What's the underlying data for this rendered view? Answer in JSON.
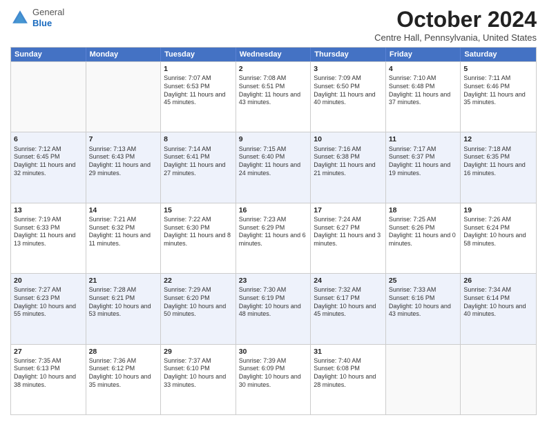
{
  "header": {
    "logo_line1": "General",
    "logo_line2": "Blue",
    "month": "October 2024",
    "location": "Centre Hall, Pennsylvania, United States"
  },
  "days": [
    "Sunday",
    "Monday",
    "Tuesday",
    "Wednesday",
    "Thursday",
    "Friday",
    "Saturday"
  ],
  "weeks": [
    [
      {
        "day": "",
        "sunrise": "",
        "sunset": "",
        "daylight": "",
        "empty": true
      },
      {
        "day": "",
        "sunrise": "",
        "sunset": "",
        "daylight": "",
        "empty": true
      },
      {
        "day": "1",
        "sunrise": "Sunrise: 7:07 AM",
        "sunset": "Sunset: 6:53 PM",
        "daylight": "Daylight: 11 hours and 45 minutes."
      },
      {
        "day": "2",
        "sunrise": "Sunrise: 7:08 AM",
        "sunset": "Sunset: 6:51 PM",
        "daylight": "Daylight: 11 hours and 43 minutes."
      },
      {
        "day": "3",
        "sunrise": "Sunrise: 7:09 AM",
        "sunset": "Sunset: 6:50 PM",
        "daylight": "Daylight: 11 hours and 40 minutes."
      },
      {
        "day": "4",
        "sunrise": "Sunrise: 7:10 AM",
        "sunset": "Sunset: 6:48 PM",
        "daylight": "Daylight: 11 hours and 37 minutes."
      },
      {
        "day": "5",
        "sunrise": "Sunrise: 7:11 AM",
        "sunset": "Sunset: 6:46 PM",
        "daylight": "Daylight: 11 hours and 35 minutes."
      }
    ],
    [
      {
        "day": "6",
        "sunrise": "Sunrise: 7:12 AM",
        "sunset": "Sunset: 6:45 PM",
        "daylight": "Daylight: 11 hours and 32 minutes."
      },
      {
        "day": "7",
        "sunrise": "Sunrise: 7:13 AM",
        "sunset": "Sunset: 6:43 PM",
        "daylight": "Daylight: 11 hours and 29 minutes."
      },
      {
        "day": "8",
        "sunrise": "Sunrise: 7:14 AM",
        "sunset": "Sunset: 6:41 PM",
        "daylight": "Daylight: 11 hours and 27 minutes."
      },
      {
        "day": "9",
        "sunrise": "Sunrise: 7:15 AM",
        "sunset": "Sunset: 6:40 PM",
        "daylight": "Daylight: 11 hours and 24 minutes."
      },
      {
        "day": "10",
        "sunrise": "Sunrise: 7:16 AM",
        "sunset": "Sunset: 6:38 PM",
        "daylight": "Daylight: 11 hours and 21 minutes."
      },
      {
        "day": "11",
        "sunrise": "Sunrise: 7:17 AM",
        "sunset": "Sunset: 6:37 PM",
        "daylight": "Daylight: 11 hours and 19 minutes."
      },
      {
        "day": "12",
        "sunrise": "Sunrise: 7:18 AM",
        "sunset": "Sunset: 6:35 PM",
        "daylight": "Daylight: 11 hours and 16 minutes."
      }
    ],
    [
      {
        "day": "13",
        "sunrise": "Sunrise: 7:19 AM",
        "sunset": "Sunset: 6:33 PM",
        "daylight": "Daylight: 11 hours and 13 minutes."
      },
      {
        "day": "14",
        "sunrise": "Sunrise: 7:21 AM",
        "sunset": "Sunset: 6:32 PM",
        "daylight": "Daylight: 11 hours and 11 minutes."
      },
      {
        "day": "15",
        "sunrise": "Sunrise: 7:22 AM",
        "sunset": "Sunset: 6:30 PM",
        "daylight": "Daylight: 11 hours and 8 minutes."
      },
      {
        "day": "16",
        "sunrise": "Sunrise: 7:23 AM",
        "sunset": "Sunset: 6:29 PM",
        "daylight": "Daylight: 11 hours and 6 minutes."
      },
      {
        "day": "17",
        "sunrise": "Sunrise: 7:24 AM",
        "sunset": "Sunset: 6:27 PM",
        "daylight": "Daylight: 11 hours and 3 minutes."
      },
      {
        "day": "18",
        "sunrise": "Sunrise: 7:25 AM",
        "sunset": "Sunset: 6:26 PM",
        "daylight": "Daylight: 11 hours and 0 minutes."
      },
      {
        "day": "19",
        "sunrise": "Sunrise: 7:26 AM",
        "sunset": "Sunset: 6:24 PM",
        "daylight": "Daylight: 10 hours and 58 minutes."
      }
    ],
    [
      {
        "day": "20",
        "sunrise": "Sunrise: 7:27 AM",
        "sunset": "Sunset: 6:23 PM",
        "daylight": "Daylight: 10 hours and 55 minutes."
      },
      {
        "day": "21",
        "sunrise": "Sunrise: 7:28 AM",
        "sunset": "Sunset: 6:21 PM",
        "daylight": "Daylight: 10 hours and 53 minutes."
      },
      {
        "day": "22",
        "sunrise": "Sunrise: 7:29 AM",
        "sunset": "Sunset: 6:20 PM",
        "daylight": "Daylight: 10 hours and 50 minutes."
      },
      {
        "day": "23",
        "sunrise": "Sunrise: 7:30 AM",
        "sunset": "Sunset: 6:19 PM",
        "daylight": "Daylight: 10 hours and 48 minutes."
      },
      {
        "day": "24",
        "sunrise": "Sunrise: 7:32 AM",
        "sunset": "Sunset: 6:17 PM",
        "daylight": "Daylight: 10 hours and 45 minutes."
      },
      {
        "day": "25",
        "sunrise": "Sunrise: 7:33 AM",
        "sunset": "Sunset: 6:16 PM",
        "daylight": "Daylight: 10 hours and 43 minutes."
      },
      {
        "day": "26",
        "sunrise": "Sunrise: 7:34 AM",
        "sunset": "Sunset: 6:14 PM",
        "daylight": "Daylight: 10 hours and 40 minutes."
      }
    ],
    [
      {
        "day": "27",
        "sunrise": "Sunrise: 7:35 AM",
        "sunset": "Sunset: 6:13 PM",
        "daylight": "Daylight: 10 hours and 38 minutes."
      },
      {
        "day": "28",
        "sunrise": "Sunrise: 7:36 AM",
        "sunset": "Sunset: 6:12 PM",
        "daylight": "Daylight: 10 hours and 35 minutes."
      },
      {
        "day": "29",
        "sunrise": "Sunrise: 7:37 AM",
        "sunset": "Sunset: 6:10 PM",
        "daylight": "Daylight: 10 hours and 33 minutes."
      },
      {
        "day": "30",
        "sunrise": "Sunrise: 7:39 AM",
        "sunset": "Sunset: 6:09 PM",
        "daylight": "Daylight: 10 hours and 30 minutes."
      },
      {
        "day": "31",
        "sunrise": "Sunrise: 7:40 AM",
        "sunset": "Sunset: 6:08 PM",
        "daylight": "Daylight: 10 hours and 28 minutes."
      },
      {
        "day": "",
        "sunrise": "",
        "sunset": "",
        "daylight": "",
        "empty": true
      },
      {
        "day": "",
        "sunrise": "",
        "sunset": "",
        "daylight": "",
        "empty": true
      }
    ]
  ]
}
